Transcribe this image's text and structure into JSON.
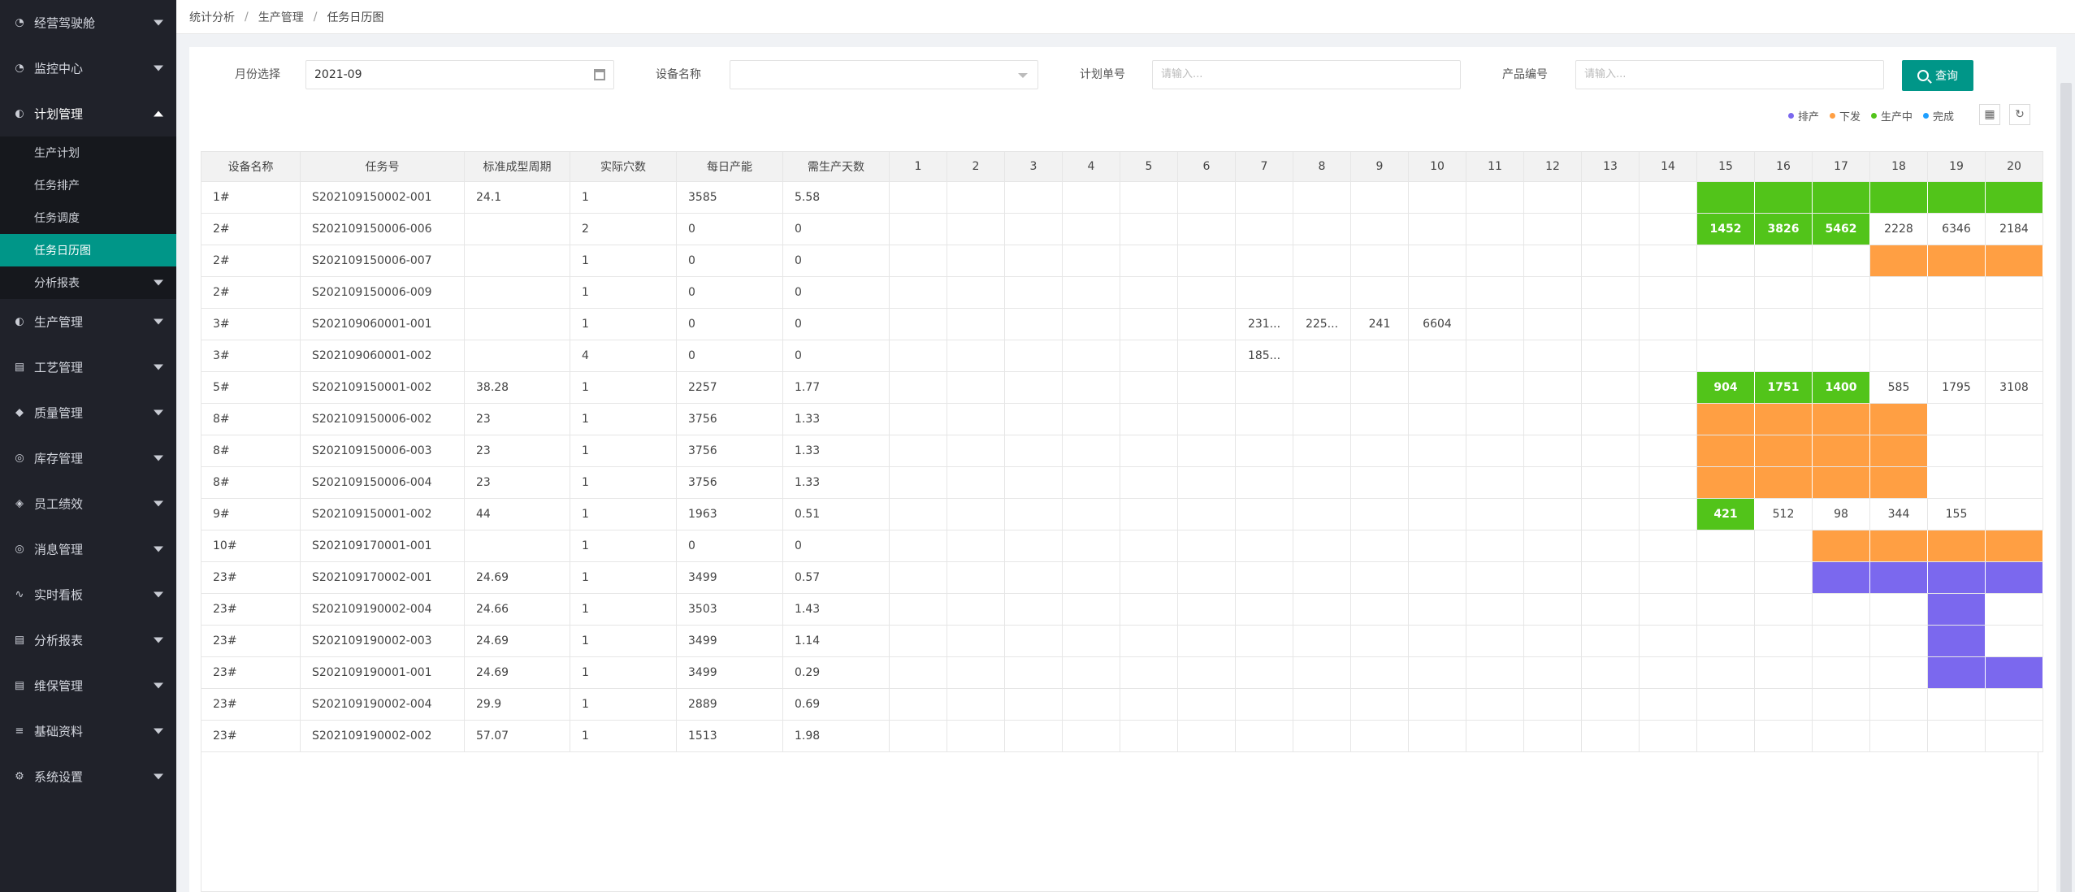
{
  "sidebar": {
    "items": [
      {
        "label": "经营驾驶舱",
        "icon": "dashboard-icon"
      },
      {
        "label": "监控中心",
        "icon": "monitor-icon"
      },
      {
        "label": "计划管理",
        "icon": "plan-icon",
        "open": true
      },
      {
        "label": "生产管理",
        "icon": "production-icon"
      },
      {
        "label": "工艺管理",
        "icon": "process-icon"
      },
      {
        "label": "质量管理",
        "icon": "quality-icon"
      },
      {
        "label": "库存管理",
        "icon": "inventory-icon"
      },
      {
        "label": "员工绩效",
        "icon": "shield-icon"
      },
      {
        "label": "消息管理",
        "icon": "message-icon"
      },
      {
        "label": "实时看板",
        "icon": "pulse-icon"
      },
      {
        "label": "分析报表",
        "icon": "report-icon"
      },
      {
        "label": "维保管理",
        "icon": "maintenance-icon"
      },
      {
        "label": "基础资料",
        "icon": "list-icon"
      },
      {
        "label": "系统设置",
        "icon": "gear-icon"
      }
    ],
    "sub_items": [
      "生产计划",
      "任务排产",
      "任务调度",
      "任务日历图",
      "分析报表"
    ],
    "active_sub": "任务日历图"
  },
  "breadcrumb": [
    "统计分析",
    "生产管理",
    "任务日历图"
  ],
  "filters": {
    "month_label": "月份选择",
    "month_value": "2021-09",
    "device_label": "设备名称",
    "device_value": "",
    "plan_label": "计划单号",
    "plan_placeholder": "请输入...",
    "product_label": "产品编号",
    "product_placeholder": "请输入...",
    "query_label": "查询"
  },
  "legend": [
    {
      "label": "排产",
      "color": "#7b68ee"
    },
    {
      "label": "下发",
      "color": "#ff9f43"
    },
    {
      "label": "生产中",
      "color": "#52c41a"
    },
    {
      "label": "完成",
      "color": "#1e9fff"
    }
  ],
  "table": {
    "columns": [
      "设备名称",
      "任务号",
      "标准成型周期",
      "实际穴数",
      "每日产能",
      "需生产天数"
    ],
    "days": [
      "1",
      "2",
      "3",
      "4",
      "5",
      "6",
      "7",
      "8",
      "9",
      "10",
      "11",
      "12",
      "13",
      "14",
      "15",
      "16",
      "17",
      "18",
      "19",
      "20"
    ],
    "rows": [
      {
        "device": "1#",
        "task": "S202109150002-001",
        "cycle": "24.1",
        "cavities": "1",
        "capacity": "3585",
        "days_needed": "5.58",
        "cells": {
          "15": {
            "s": "green"
          },
          "16": {
            "s": "green"
          },
          "17": {
            "s": "green"
          },
          "18": {
            "s": "green"
          },
          "19": {
            "s": "green"
          },
          "20": {
            "s": "green"
          }
        }
      },
      {
        "device": "2#",
        "task": "S202109150006-006",
        "cycle": "",
        "cavities": "2",
        "capacity": "0",
        "days_needed": "0",
        "cells": {
          "15": {
            "s": "green",
            "t": "1452"
          },
          "16": {
            "s": "green",
            "t": "3826"
          },
          "17": {
            "s": "green",
            "t": "5462"
          },
          "18": {
            "t": "2228"
          },
          "19": {
            "t": "6346"
          },
          "20": {
            "t": "2184"
          }
        }
      },
      {
        "device": "2#",
        "task": "S202109150006-007",
        "cycle": "",
        "cavities": "1",
        "capacity": "0",
        "days_needed": "0",
        "cells": {
          "18": {
            "s": "orange"
          },
          "19": {
            "s": "orange"
          },
          "20": {
            "s": "orange"
          }
        }
      },
      {
        "device": "2#",
        "task": "S202109150006-009",
        "cycle": "",
        "cavities": "1",
        "capacity": "0",
        "days_needed": "0",
        "cells": {}
      },
      {
        "device": "3#",
        "task": "S202109060001-001",
        "cycle": "",
        "cavities": "1",
        "capacity": "0",
        "days_needed": "0",
        "cells": {
          "7": {
            "t": "231..."
          },
          "8": {
            "t": "225..."
          },
          "9": {
            "t": "241"
          },
          "10": {
            "t": "6604"
          }
        }
      },
      {
        "device": "3#",
        "task": "S202109060001-002",
        "cycle": "",
        "cavities": "4",
        "capacity": "0",
        "days_needed": "0",
        "cells": {
          "7": {
            "t": "185..."
          }
        }
      },
      {
        "device": "5#",
        "task": "S202109150001-002",
        "cycle": "38.28",
        "cavities": "1",
        "capacity": "2257",
        "days_needed": "1.77",
        "cells": {
          "15": {
            "s": "green",
            "t": "904"
          },
          "16": {
            "s": "green",
            "t": "1751"
          },
          "17": {
            "s": "green",
            "t": "1400"
          },
          "18": {
            "t": "585"
          },
          "19": {
            "t": "1795"
          },
          "20": {
            "t": "3108"
          }
        }
      },
      {
        "device": "8#",
        "task": "S202109150006-002",
        "cycle": "23",
        "cavities": "1",
        "capacity": "3756",
        "days_needed": "1.33",
        "cells": {
          "15": {
            "s": "orange"
          },
          "16": {
            "s": "orange"
          },
          "17": {
            "s": "orange"
          },
          "18": {
            "s": "orange"
          }
        }
      },
      {
        "device": "8#",
        "task": "S202109150006-003",
        "cycle": "23",
        "cavities": "1",
        "capacity": "3756",
        "days_needed": "1.33",
        "cells": {
          "15": {
            "s": "orange"
          },
          "16": {
            "s": "orange"
          },
          "17": {
            "s": "orange"
          },
          "18": {
            "s": "orange"
          }
        }
      },
      {
        "device": "8#",
        "task": "S202109150006-004",
        "cycle": "23",
        "cavities": "1",
        "capacity": "3756",
        "days_needed": "1.33",
        "cells": {
          "15": {
            "s": "orange"
          },
          "16": {
            "s": "orange"
          },
          "17": {
            "s": "orange"
          },
          "18": {
            "s": "orange"
          }
        }
      },
      {
        "device": "9#",
        "task": "S202109150001-002",
        "cycle": "44",
        "cavities": "1",
        "capacity": "1963",
        "days_needed": "0.51",
        "cells": {
          "15": {
            "s": "green",
            "t": "421"
          },
          "16": {
            "t": "512"
          },
          "17": {
            "t": "98"
          },
          "18": {
            "t": "344"
          },
          "19": {
            "t": "155"
          }
        }
      },
      {
        "device": "10#",
        "task": "S202109170001-001",
        "cycle": "",
        "cavities": "1",
        "capacity": "0",
        "days_needed": "0",
        "cells": {
          "17": {
            "s": "orange"
          },
          "18": {
            "s": "orange"
          },
          "19": {
            "s": "orange"
          },
          "20": {
            "s": "orange"
          }
        }
      },
      {
        "device": "23#",
        "task": "S202109170002-001",
        "cycle": "24.69",
        "cavities": "1",
        "capacity": "3499",
        "days_needed": "0.57",
        "cells": {
          "17": {
            "s": "purple"
          },
          "18": {
            "s": "purple"
          },
          "19": {
            "s": "purple"
          },
          "20": {
            "s": "purple"
          }
        }
      },
      {
        "device": "23#",
        "task": "S202109190002-004",
        "cycle": "24.66",
        "cavities": "1",
        "capacity": "3503",
        "days_needed": "1.43",
        "cells": {
          "19": {
            "s": "purple"
          }
        }
      },
      {
        "device": "23#",
        "task": "S202109190002-003",
        "cycle": "24.69",
        "cavities": "1",
        "capacity": "3499",
        "days_needed": "1.14",
        "cells": {
          "19": {
            "s": "purple"
          }
        }
      },
      {
        "device": "23#",
        "task": "S202109190001-001",
        "cycle": "24.69",
        "cavities": "1",
        "capacity": "3499",
        "days_needed": "0.29",
        "cells": {
          "19": {
            "s": "purple"
          },
          "20": {
            "s": "purple"
          }
        }
      },
      {
        "device": "23#",
        "task": "S202109190002-004",
        "cycle": "29.9",
        "cavities": "1",
        "capacity": "2889",
        "days_needed": "0.69",
        "cells": {}
      },
      {
        "device": "23#",
        "task": "S202109190002-002",
        "cycle": "57.07",
        "cavities": "1",
        "capacity": "1513",
        "days_needed": "1.98",
        "cells": {}
      }
    ]
  }
}
